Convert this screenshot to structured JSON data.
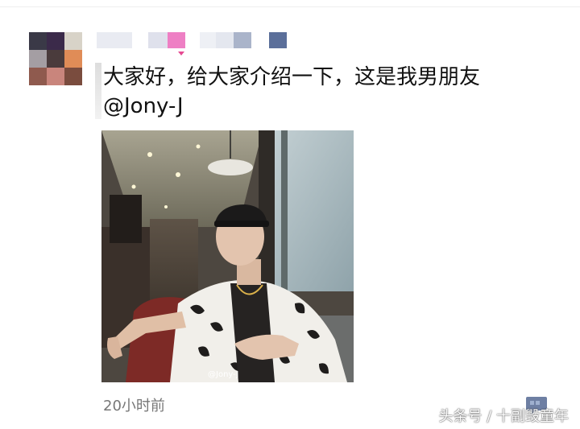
{
  "post": {
    "text_line1": "大家好，给大家介绍一下，这是我男朋友",
    "mention": "@Jony-J",
    "timestamp": "20小时前"
  },
  "photo": {
    "watermark": "@Jony-J"
  },
  "page_watermark": "头条号 / 十副毁童年",
  "colors": {
    "nickname_accent": "#e64a92",
    "timestamp": "#777777"
  },
  "icons": {
    "avatar": "pixelated-avatar",
    "comment": "comment-icon"
  }
}
